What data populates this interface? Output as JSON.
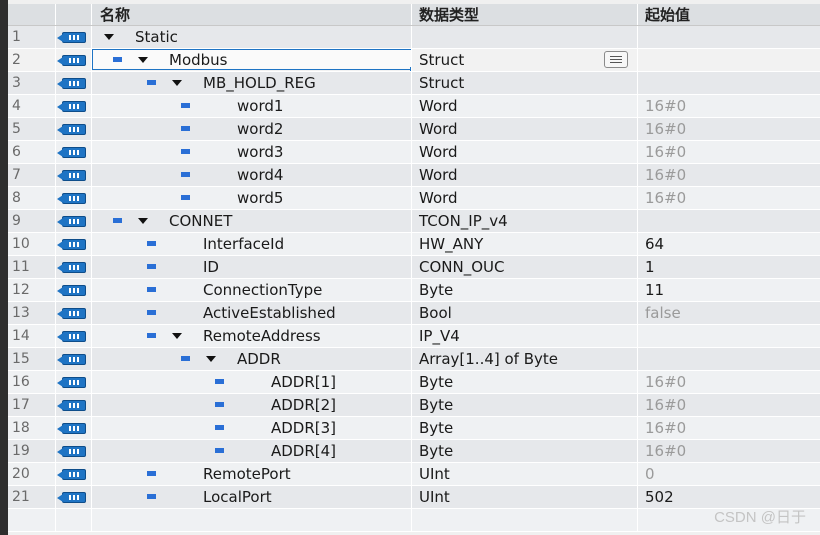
{
  "headers": {
    "name": "名称",
    "type": "数据类型",
    "start": "起始值"
  },
  "rows": [
    {
      "num": "1",
      "name": "Static",
      "type": "",
      "start": "",
      "level": 0,
      "bullet": false,
      "expanded": true,
      "dim": false
    },
    {
      "num": "2",
      "name": "Modbus",
      "type": "Struct",
      "start": "",
      "level": 1,
      "bullet": true,
      "expanded": true,
      "dim": false,
      "selected": true
    },
    {
      "num": "3",
      "name": "MB_HOLD_REG",
      "type": "Struct",
      "start": "",
      "level": 2,
      "bullet": true,
      "expanded": true,
      "dim": false
    },
    {
      "num": "4",
      "name": "word1",
      "type": "Word",
      "start": "16#0",
      "level": 3,
      "bullet": true,
      "expanded": false,
      "dim": true
    },
    {
      "num": "5",
      "name": "word2",
      "type": "Word",
      "start": "16#0",
      "level": 3,
      "bullet": true,
      "expanded": false,
      "dim": true
    },
    {
      "num": "6",
      "name": "word3",
      "type": "Word",
      "start": "16#0",
      "level": 3,
      "bullet": true,
      "expanded": false,
      "dim": true
    },
    {
      "num": "7",
      "name": "word4",
      "type": "Word",
      "start": "16#0",
      "level": 3,
      "bullet": true,
      "expanded": false,
      "dim": true
    },
    {
      "num": "8",
      "name": "word5",
      "type": "Word",
      "start": "16#0",
      "level": 3,
      "bullet": true,
      "expanded": false,
      "dim": true
    },
    {
      "num": "9",
      "name": "CONNET",
      "type": "TCON_IP_v4",
      "start": "",
      "level": 1,
      "bullet": true,
      "expanded": true,
      "dim": false
    },
    {
      "num": "10",
      "name": "InterfaceId",
      "type": "HW_ANY",
      "start": "64",
      "level": 2,
      "bullet": true,
      "expanded": false,
      "dim": false
    },
    {
      "num": "11",
      "name": "ID",
      "type": "CONN_OUC",
      "start": "1",
      "level": 2,
      "bullet": true,
      "expanded": false,
      "dim": false
    },
    {
      "num": "12",
      "name": "ConnectionType",
      "type": "Byte",
      "start": "11",
      "level": 2,
      "bullet": true,
      "expanded": false,
      "dim": false
    },
    {
      "num": "13",
      "name": "ActiveEstablished",
      "type": "Bool",
      "start": "false",
      "level": 2,
      "bullet": true,
      "expanded": false,
      "dim": true
    },
    {
      "num": "14",
      "name": "RemoteAddress",
      "type": "IP_V4",
      "start": "",
      "level": 2,
      "bullet": true,
      "expanded": true,
      "dim": false
    },
    {
      "num": "15",
      "name": "ADDR",
      "type": "Array[1..4] of Byte",
      "start": "",
      "level": 3,
      "bullet": true,
      "expanded": true,
      "dim": false
    },
    {
      "num": "16",
      "name": "ADDR[1]",
      "type": "Byte",
      "start": "16#0",
      "level": 4,
      "bullet": true,
      "expanded": false,
      "dim": true
    },
    {
      "num": "17",
      "name": "ADDR[2]",
      "type": "Byte",
      "start": "16#0",
      "level": 4,
      "bullet": true,
      "expanded": false,
      "dim": true
    },
    {
      "num": "18",
      "name": "ADDR[3]",
      "type": "Byte",
      "start": "16#0",
      "level": 4,
      "bullet": true,
      "expanded": false,
      "dim": true
    },
    {
      "num": "19",
      "name": "ADDR[4]",
      "type": "Byte",
      "start": "16#0",
      "level": 4,
      "bullet": true,
      "expanded": false,
      "dim": true
    },
    {
      "num": "20",
      "name": "RemotePort",
      "type": "UInt",
      "start": "0",
      "level": 2,
      "bullet": true,
      "expanded": false,
      "dim": true
    },
    {
      "num": "21",
      "name": "LocalPort",
      "type": "UInt",
      "start": "502",
      "level": 2,
      "bullet": true,
      "expanded": false,
      "dim": false
    }
  ],
  "row_icon": "interface-icon",
  "watermark": "CSDN @日于",
  "colors": {
    "accent": "#1f74c4",
    "bullet": "#2a6fd6",
    "dim_text": "#9a9a9a"
  }
}
